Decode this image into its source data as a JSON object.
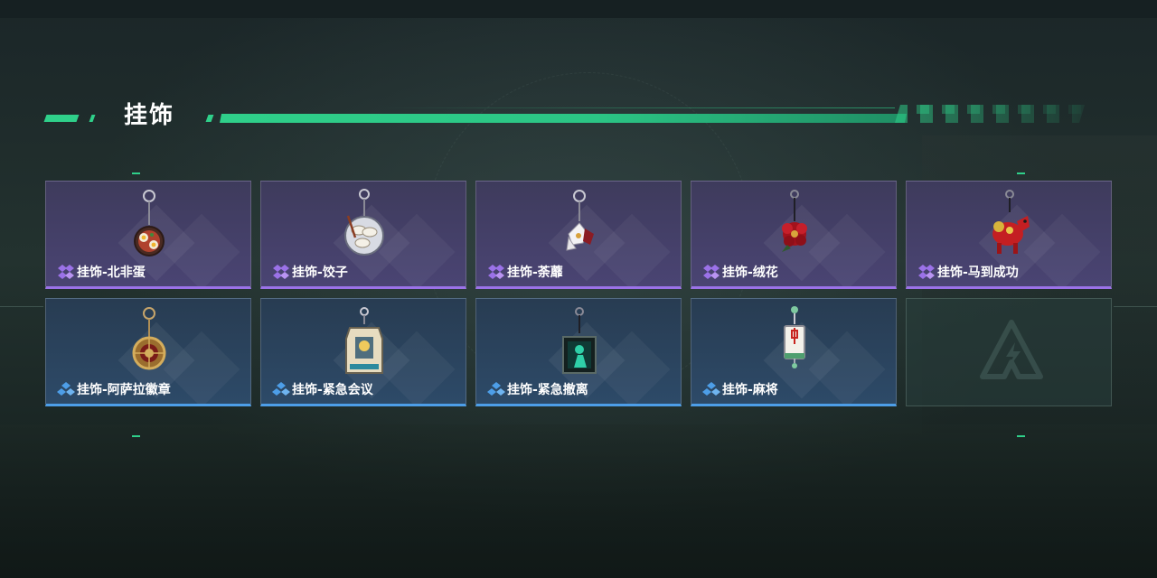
{
  "header": {
    "title": "挂饰"
  },
  "colors": {
    "accent": "#2fd08a",
    "rarity_purple": "#9b72e8",
    "rarity_blue": "#4d9ee8",
    "purple_bg": "#46416b",
    "blue_bg": "#2b445f"
  },
  "items": [
    {
      "name": "挂饰-北非蛋",
      "rarity": "purple",
      "icon": "shakshuka-pendant-icon"
    },
    {
      "name": "挂饰-饺子",
      "rarity": "purple",
      "icon": "dumpling-plate-pendant-icon"
    },
    {
      "name": "挂饰-荼蘼",
      "rarity": "purple",
      "icon": "flower-pendant-icon"
    },
    {
      "name": "挂饰-绒花",
      "rarity": "purple",
      "icon": "velvet-flower-pendant-icon"
    },
    {
      "name": "挂饰-马到成功",
      "rarity": "purple",
      "icon": "red-horse-pendant-icon"
    },
    {
      "name": "挂饰-阿萨拉徽章",
      "rarity": "blue",
      "icon": "asala-badge-pendant-icon"
    },
    {
      "name": "挂饰-紧急会议",
      "rarity": "blue",
      "icon": "emergency-meeting-pendant-icon"
    },
    {
      "name": "挂饰-紧急撤离",
      "rarity": "blue",
      "icon": "emergency-evac-pendant-icon"
    },
    {
      "name": "挂饰-麻将",
      "rarity": "blue",
      "icon": "mahjong-tile-pendant-icon"
    }
  ],
  "empty_slot": {
    "icon": "game-logo-icon"
  }
}
